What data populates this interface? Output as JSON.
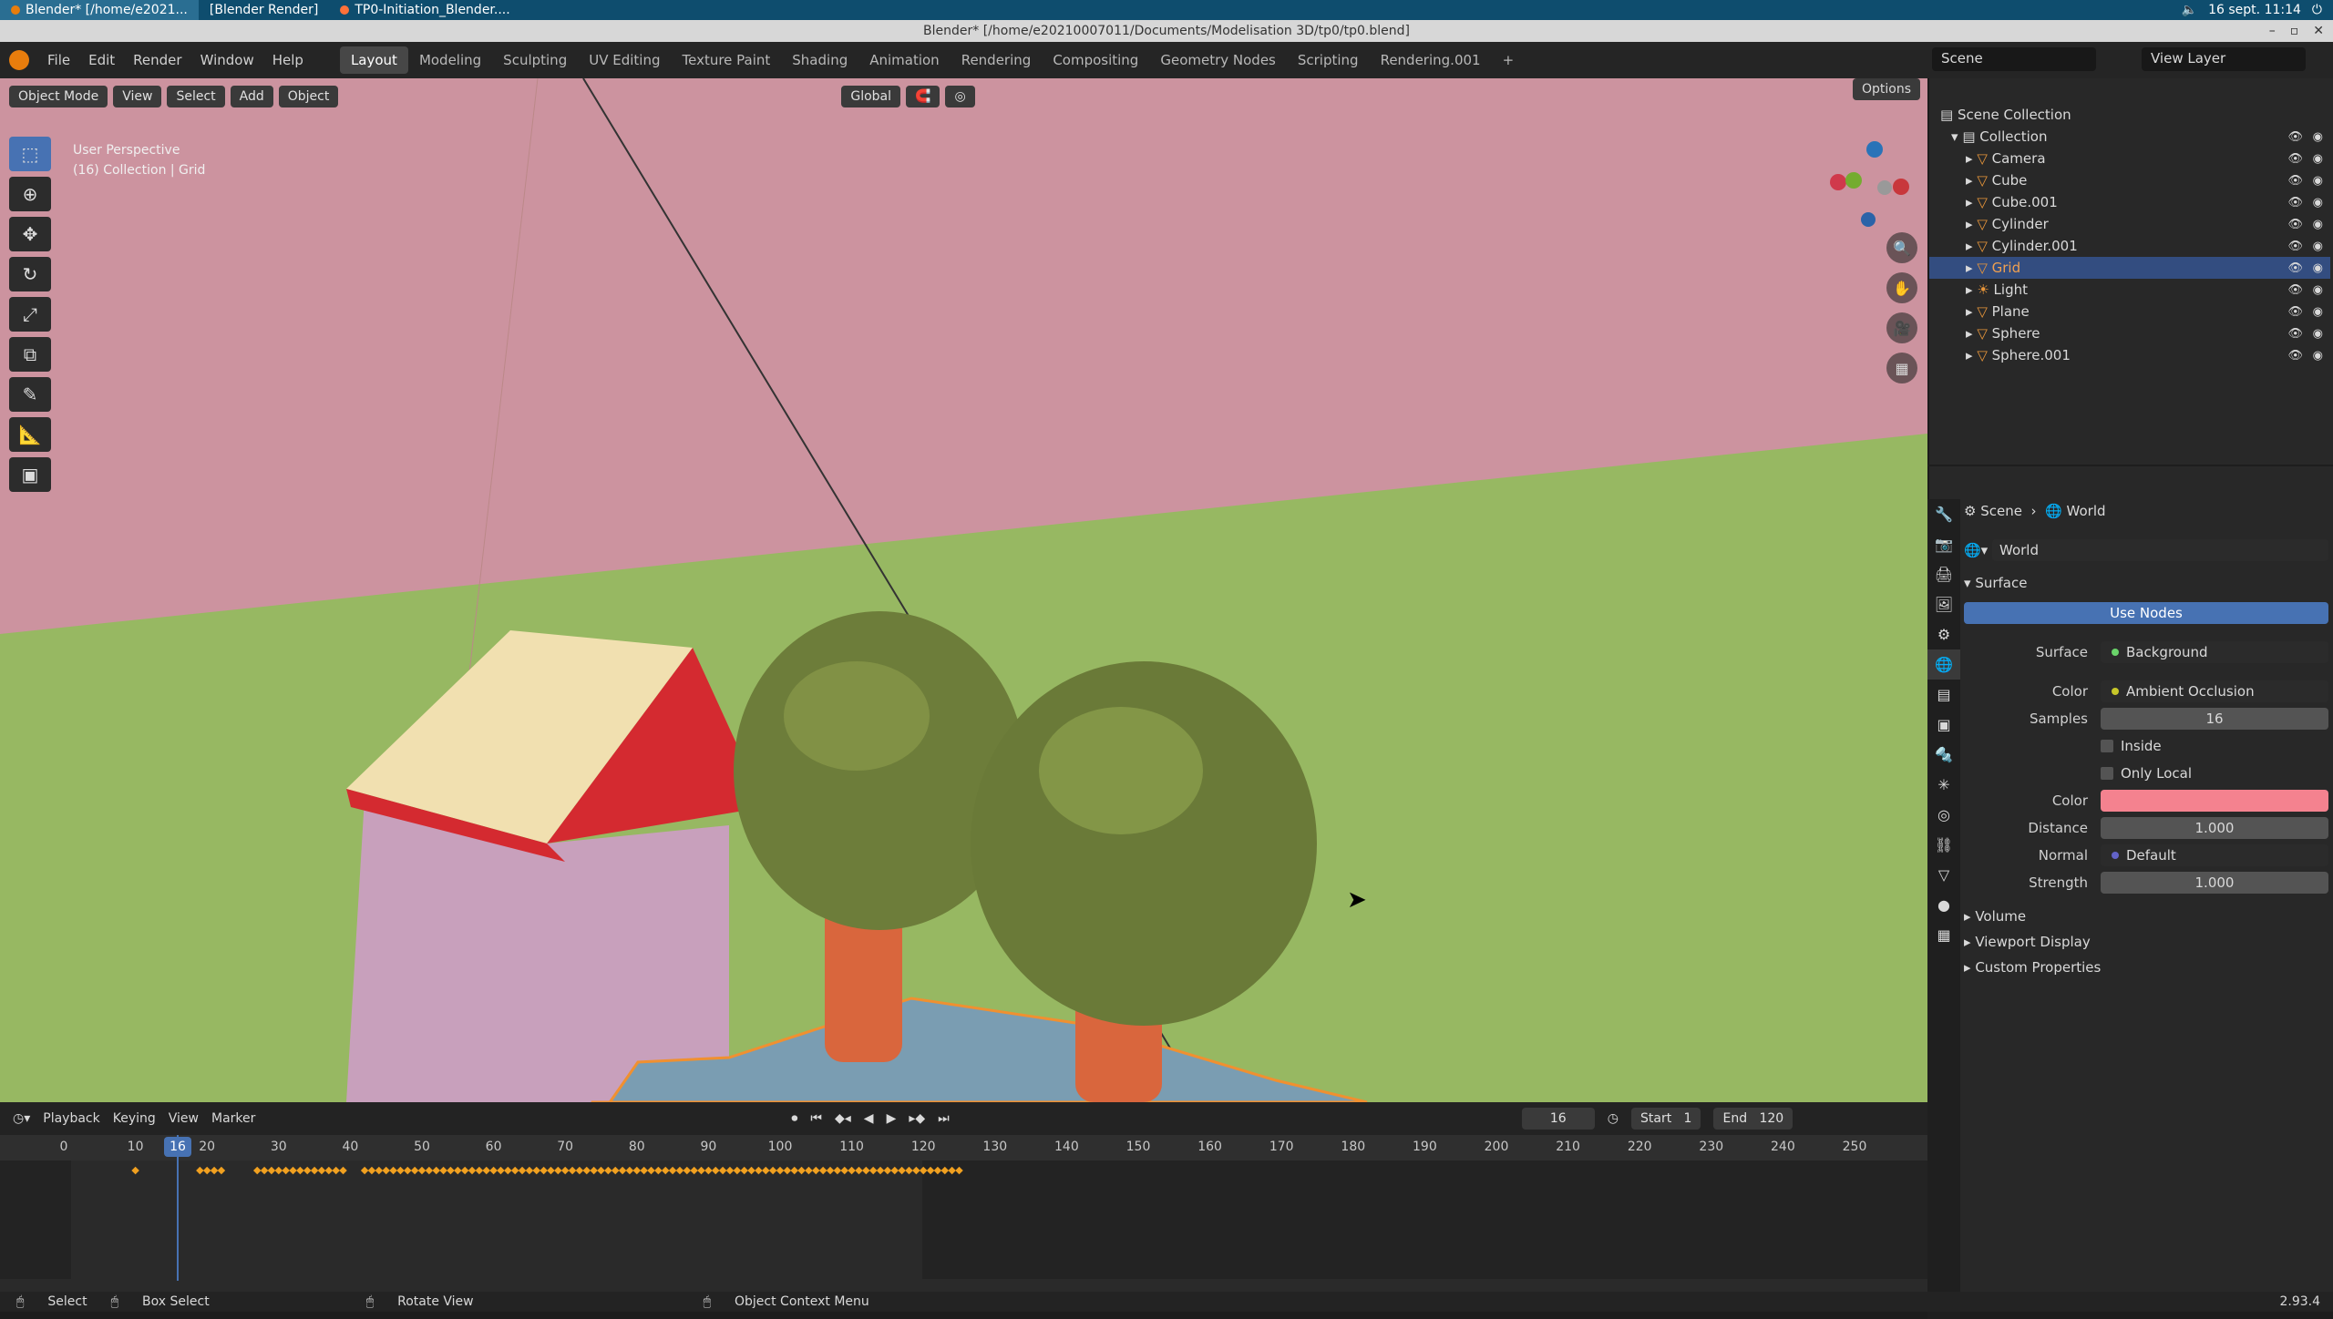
{
  "system": {
    "tabs": [
      "Blender* [/home/e2021...",
      "[Blender Render]",
      "TP0-Initiation_Blender...."
    ],
    "datetime": "16 sept. 11:14"
  },
  "window": {
    "title": "Blender* [/home/e20210007011/Documents/Modelisation 3D/tp0/tp0.blend]"
  },
  "menu": [
    "File",
    "Edit",
    "Render",
    "Window",
    "Help"
  ],
  "workspaces": [
    "Layout",
    "Modeling",
    "Sculpting",
    "UV Editing",
    "Texture Paint",
    "Shading",
    "Animation",
    "Rendering",
    "Compositing",
    "Geometry Nodes",
    "Scripting",
    "Rendering.001"
  ],
  "scene_name": "Scene",
  "view_layer": "View Layer",
  "viewport": {
    "mode": "Object Mode",
    "header_menus": [
      "View",
      "Select",
      "Add",
      "Object"
    ],
    "transform": "Global",
    "options": "Options",
    "perspective": "User Perspective",
    "context": "(16) Collection | Grid",
    "colors": {
      "sky": "#cc939f",
      "ground": "#97b862",
      "roof": "#d42a30",
      "roof_top": "#f1e0b0",
      "wall": "#c8a0bc",
      "trunk": "#d9663d",
      "water": "#7a9db2"
    }
  },
  "outliner": {
    "root": "Scene Collection",
    "collection": "Collection",
    "items": [
      "Camera",
      "Cube",
      "Cube.001",
      "Cylinder",
      "Cylinder.001",
      "Grid",
      "Light",
      "Plane",
      "Sphere",
      "Sphere.001"
    ],
    "selected": "Grid"
  },
  "properties": {
    "breadcrumb": [
      "Scene",
      "World"
    ],
    "world_name": "World",
    "surface_panel": "Surface",
    "use_nodes": "Use Nodes",
    "surface": {
      "label": "Surface",
      "value": "Background"
    },
    "color": {
      "label": "Color",
      "value": "Ambient Occlusion"
    },
    "samples": {
      "label": "Samples",
      "value": "16"
    },
    "inside": "Inside",
    "only_local": "Only Local",
    "color2": {
      "label": "Color",
      "swatch": "#f4828f"
    },
    "distance": {
      "label": "Distance",
      "value": "1.000"
    },
    "normal": {
      "label": "Normal",
      "value": "Default"
    },
    "strength": {
      "label": "Strength",
      "value": "1.000"
    },
    "collapsed_panels": [
      "Volume",
      "Viewport Display",
      "Custom Properties"
    ]
  },
  "timeline": {
    "menus": [
      "Playback",
      "Keying",
      "View",
      "Marker"
    ],
    "current_frame": "16",
    "start_label": "Start",
    "start": "1",
    "end_label": "End",
    "end": "120",
    "ticks": [
      "0",
      "10",
      "20",
      "30",
      "40",
      "50",
      "60",
      "70",
      "80",
      "90",
      "100",
      "110",
      "120",
      "130",
      "140",
      "150",
      "160",
      "170",
      "180",
      "190",
      "200",
      "210",
      "220",
      "230",
      "240",
      "250"
    ]
  },
  "status": {
    "items": [
      "Select",
      "Box Select",
      "Rotate View",
      "Object Context Menu"
    ],
    "version": "2.93.4"
  }
}
